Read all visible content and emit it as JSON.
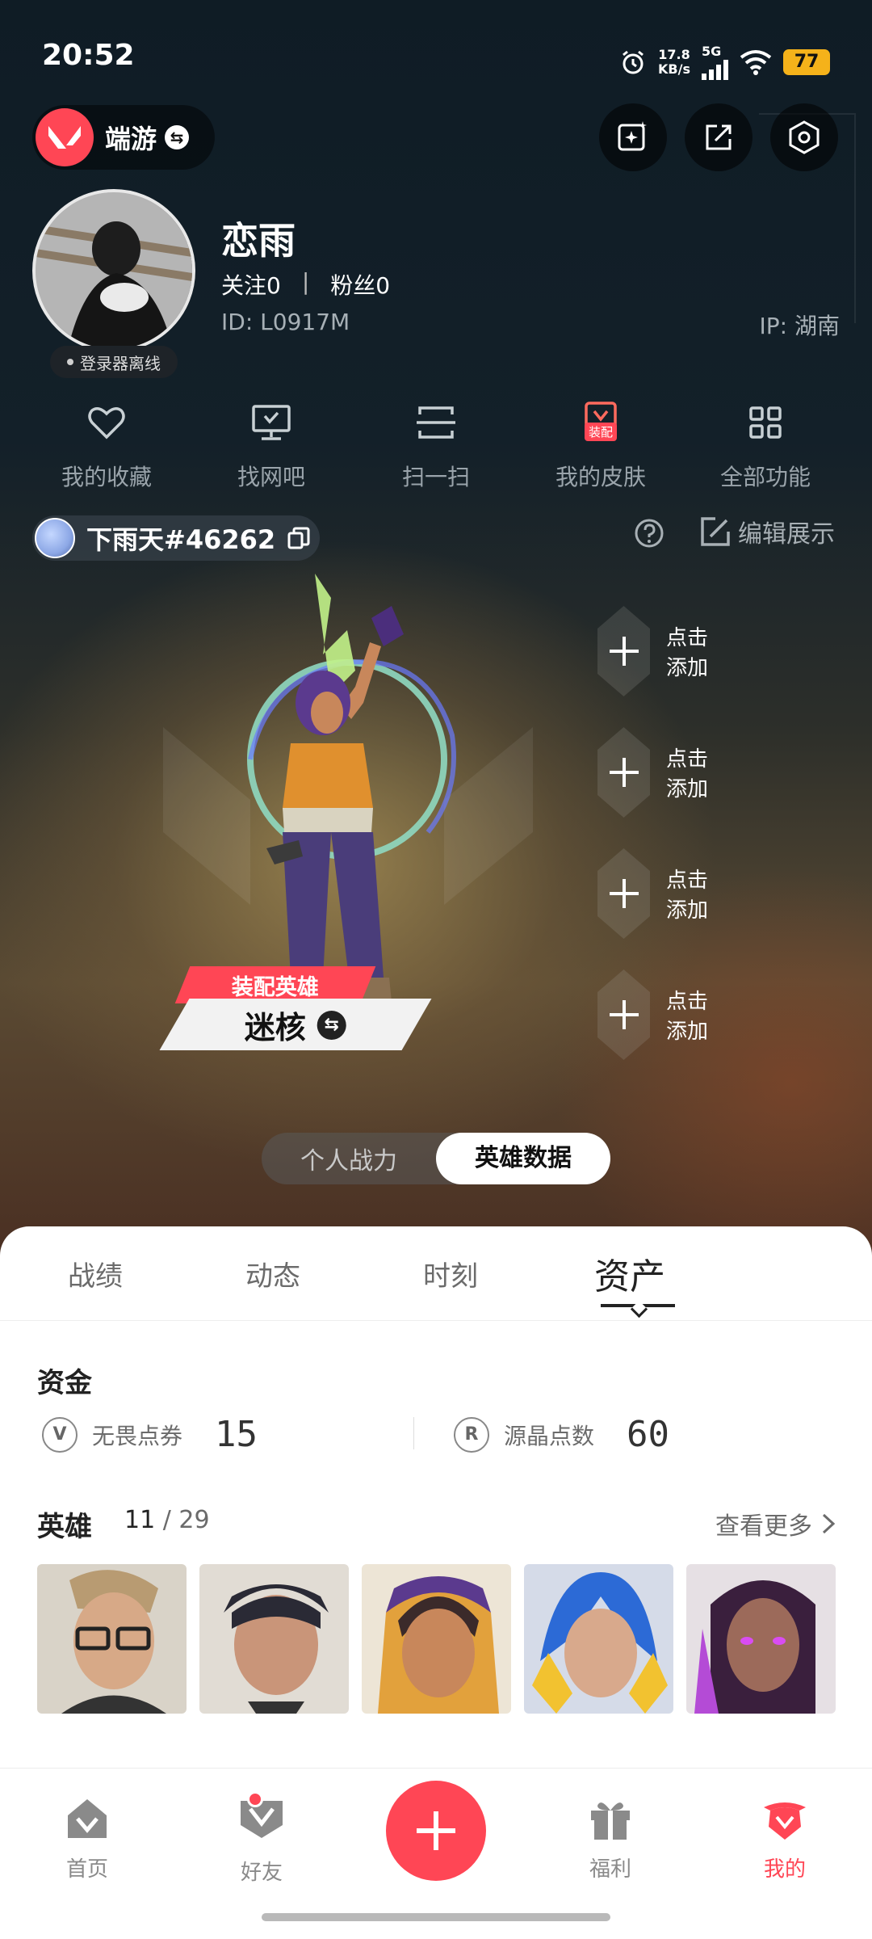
{
  "status_bar": {
    "time": "20:52",
    "net_speed_value": "17.8",
    "net_speed_unit": "KB/s",
    "network": "5G",
    "battery": "77"
  },
  "app": {
    "name": "端游",
    "accent_color": "#ff4655"
  },
  "profile": {
    "username": "恋雨",
    "follow_label": "关注",
    "follow_count": "0",
    "fans_label": "粉丝",
    "fans_count": "0",
    "separator": "|",
    "id_text": "ID: L0917M",
    "ip_text": "IP: 湖南",
    "status": "登录器离线"
  },
  "functions": [
    {
      "label": "我的收藏",
      "icon": "heart-icon"
    },
    {
      "label": "找网吧",
      "icon": "monitor-icon"
    },
    {
      "label": "扫一扫",
      "icon": "scan-icon"
    },
    {
      "label": "我的皮肤",
      "icon": "skin-icon",
      "tag": "装配"
    },
    {
      "label": "全部功能",
      "icon": "grid-icon"
    }
  ],
  "player": {
    "tag": "下雨天#46262",
    "edit_label": "编辑展示"
  },
  "showcase": {
    "equip_label": "装配英雄",
    "agent_name": "迷核",
    "slots": [
      "点击添加",
      "点击添加",
      "点击添加",
      "点击添加"
    ],
    "toggle": [
      "个人战力",
      "英雄数据"
    ],
    "toggle_active": "英雄数据"
  },
  "tabs": [
    "战绩",
    "动态",
    "时刻",
    "资产"
  ],
  "active_tab": "资产",
  "assets": {
    "funds_title": "资金",
    "funds": [
      {
        "icon": "valorant-point-icon",
        "label": "无畏点券",
        "value": "15"
      },
      {
        "icon": "radianite-icon",
        "label": "源晶点数",
        "value": "60"
      }
    ],
    "heroes_title": "英雄",
    "heroes_owned": "11",
    "heroes_total": "29",
    "see_more": "查看更多"
  },
  "nav": [
    {
      "label": "首页",
      "icon": "home-icon"
    },
    {
      "label": "好友",
      "icon": "friends-icon",
      "badge": true
    },
    {
      "label": "",
      "icon": "plus-icon"
    },
    {
      "label": "福利",
      "icon": "gift-icon"
    },
    {
      "label": "我的",
      "icon": "profile-icon",
      "active": true
    }
  ]
}
